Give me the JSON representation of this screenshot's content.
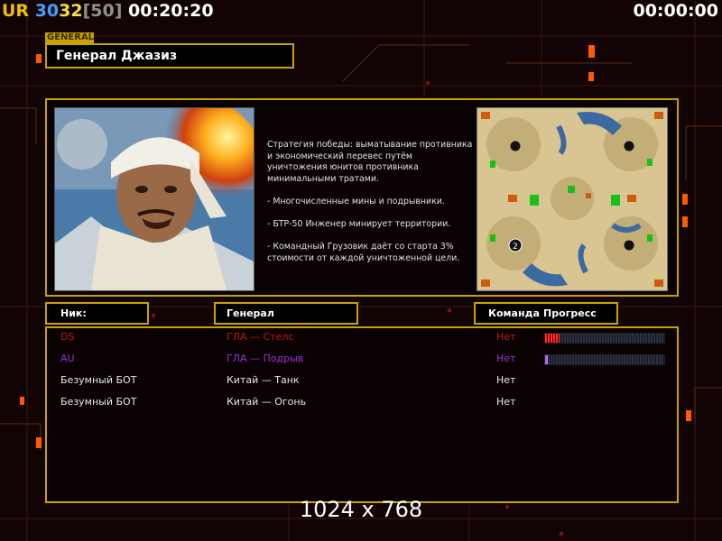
{
  "hud": {
    "ur_label": "UR",
    "stat_a": "30",
    "stat_b": "32",
    "stat_c": "[50]",
    "game_time": "00:20:20",
    "timer": "00:00:00"
  },
  "general": {
    "tag": "GENERAL",
    "name": "Генерал Джазиз",
    "description": [
      "Стратегия победы: выматывание противника и экономический перевес путём уничтожения юнитов противника минимальными тратами.",
      "- Многочисленные мины и подрывники.",
      "- БТР-50 Инженер минирует территории.",
      "- Командный Грузовик даёт со старта 3% стоимости от каждой уничтоженной цели."
    ]
  },
  "minimap": {
    "start_marker": "2"
  },
  "table": {
    "headers": {
      "nick": "Ник:",
      "general": "Генерал",
      "team": "Команда",
      "progress": "Прогресс"
    },
    "rows": [
      {
        "nick": "DS",
        "general": "ГЛА — Стелс",
        "team": "Нет",
        "color": "#c01818",
        "progress": 0.12
      },
      {
        "nick": "AU",
        "general": "ГЛА — Подрыв",
        "team": "Нет",
        "color": "#9a30e0",
        "progress": 0.02
      },
      {
        "nick": "Безумный БОТ",
        "general": "Китай — Танк",
        "team": "Нет",
        "color": "#e8e8e8"
      },
      {
        "nick": "Безумный БОТ",
        "general": "Китай — Огонь",
        "team": "Нет",
        "color": "#e8e8e8"
      }
    ]
  },
  "resolution": "1024 x 768",
  "colors": {
    "frame": "#c8a200",
    "ur": "#f0c000",
    "stat_a": "#40a0ff",
    "stat_b": "#f0e040",
    "stat_c": "#909090"
  }
}
